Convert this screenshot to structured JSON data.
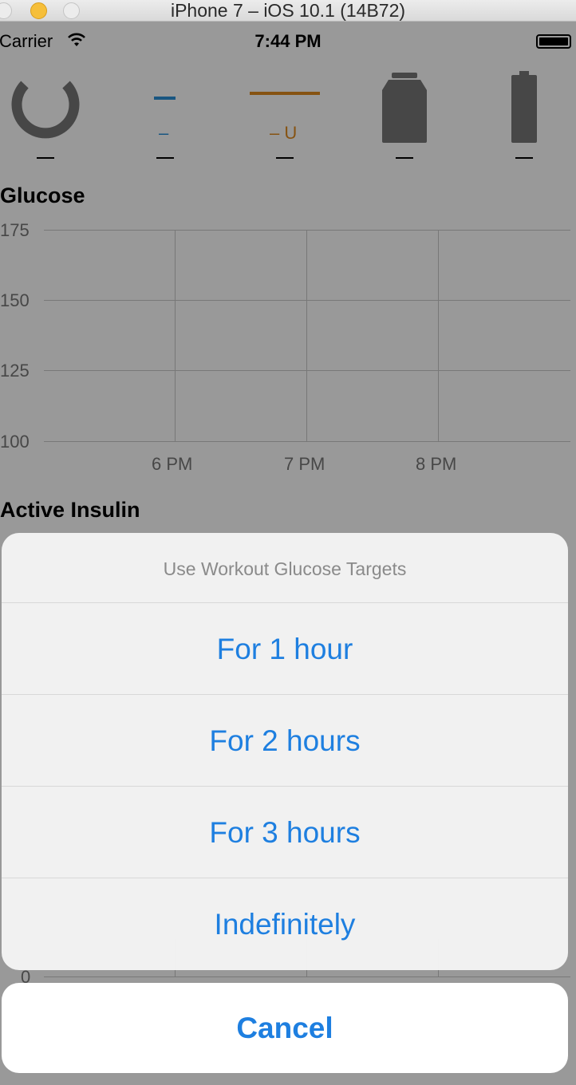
{
  "window": {
    "title": "iPhone 7 – iOS 10.1 (14B72)"
  },
  "statusbar": {
    "carrier": "Carrier",
    "time": "7:44 PM"
  },
  "hud": {
    "glucose_value": "—",
    "basal_label": "–",
    "basal_value": "—",
    "bolus_label": "– U",
    "bolus_value": "—",
    "reservoir_value": "—",
    "battery_value": "—"
  },
  "glucose_chart": {
    "title": "Glucose",
    "y_ticks": [
      "175",
      "150",
      "125",
      "100"
    ],
    "x_ticks": [
      "6 PM",
      "7 PM",
      "8 PM"
    ]
  },
  "insulin_chart": {
    "title": "Active Insulin",
    "y_ticks": [
      "0"
    ]
  },
  "action_sheet": {
    "title": "Use Workout Glucose Targets",
    "options": [
      "For 1 hour",
      "For 2 hours",
      "For 3 hours",
      "Indefinitely"
    ],
    "cancel": "Cancel"
  },
  "colors": {
    "accent": "#1e7fe0",
    "basal": "#2a8fd8",
    "bolus": "#e08a1e",
    "overlay": "rgba(0,0,0,0.40)"
  },
  "chart_data": {
    "type": "line",
    "title": "Glucose",
    "xlabel": "",
    "ylabel": "",
    "categories": [
      "6 PM",
      "7 PM",
      "8 PM"
    ],
    "series": [],
    "ylim": [
      100,
      175
    ],
    "grid": true
  }
}
